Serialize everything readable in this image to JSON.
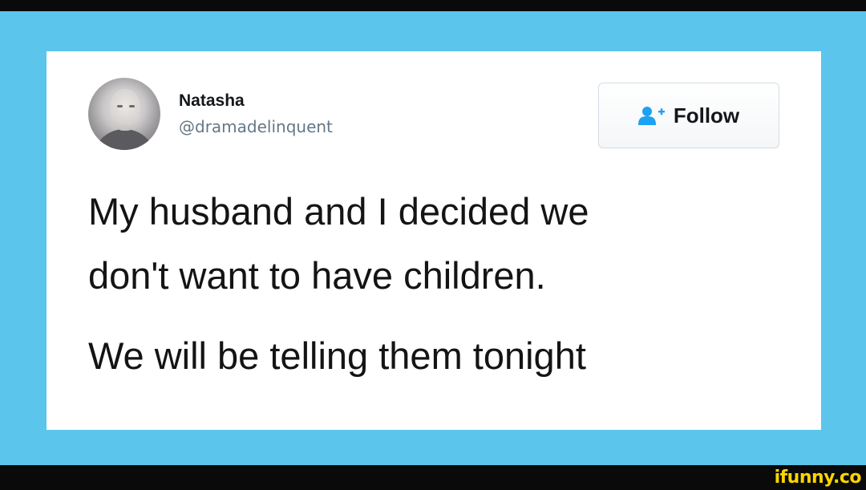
{
  "tweet": {
    "author": {
      "name": "Natasha",
      "handle": "@dramadelinquent"
    },
    "follow_button": {
      "label": "Follow",
      "icon": "add-user-icon"
    },
    "text": {
      "line1": "My husband and I decided we",
      "line2": "don't want to have children.",
      "line3": "We will be telling them tonight"
    }
  },
  "watermark": {
    "text": "ifunny.co"
  },
  "colors": {
    "frame": "#5bc5ec",
    "card": "#ffffff",
    "follow_icon": "#1da1f2",
    "watermark": "#fdd400",
    "bars": "#0a0a0a"
  }
}
